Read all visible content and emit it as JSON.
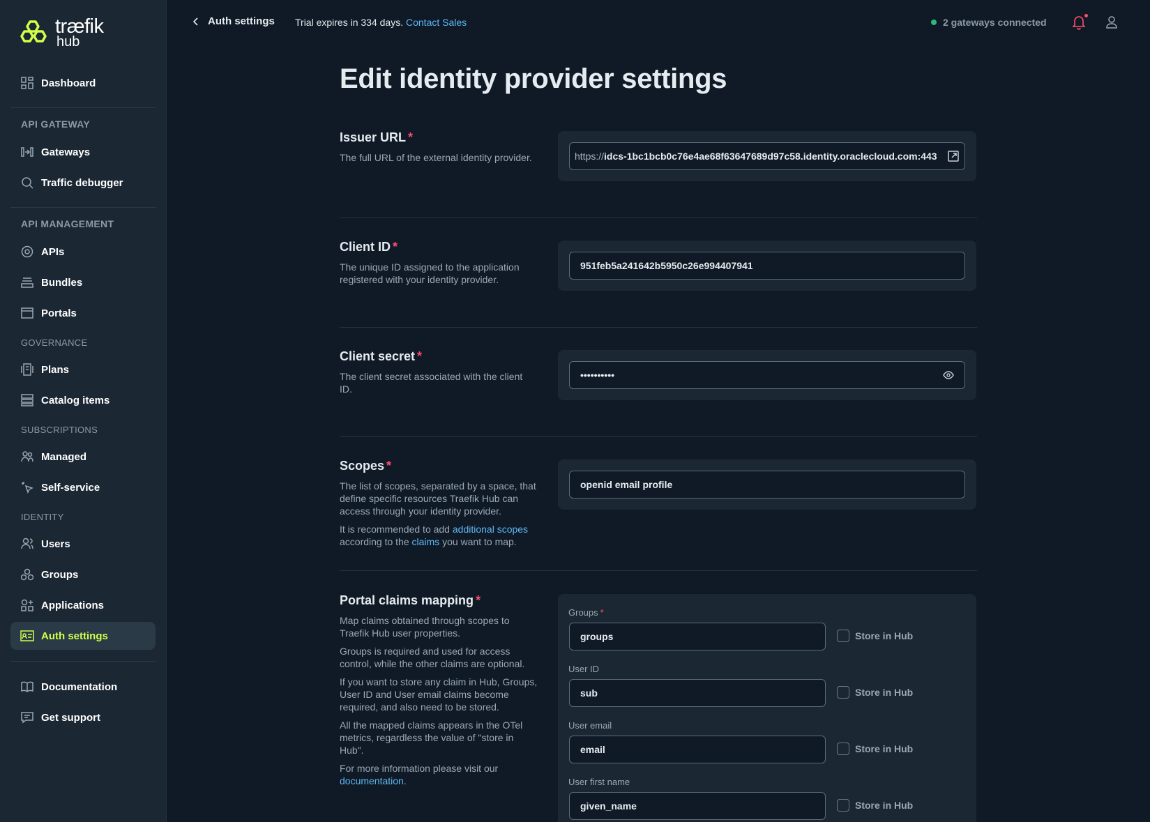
{
  "brand": {
    "name_line1": "træfik",
    "name_line2": "hub",
    "accent": "#d2ff4a"
  },
  "sidebar": {
    "dashboard": "Dashboard",
    "api_gateway_heading": "API GATEWAY",
    "gateways": "Gateways",
    "traffic_debugger": "Traffic debugger",
    "api_management_heading": "API MANAGEMENT",
    "apis": "APIs",
    "bundles": "Bundles",
    "portals": "Portals",
    "governance_heading": "GOVERNANCE",
    "plans": "Plans",
    "catalog_items": "Catalog items",
    "subscriptions_heading": "SUBSCRIPTIONS",
    "managed": "Managed",
    "self_service": "Self-service",
    "identity_heading": "IDENTITY",
    "users": "Users",
    "groups": "Groups",
    "applications": "Applications",
    "auth_settings": "Auth settings",
    "documentation": "Documentation",
    "get_support": "Get support"
  },
  "topbar": {
    "back_label": "Auth settings",
    "trial_text": "Trial expires in 334 days.",
    "contact_sales": "Contact Sales",
    "gateways_status": "2 gateways connected"
  },
  "page": {
    "title": "Edit identity provider settings",
    "issuer": {
      "label": "Issuer URL",
      "required": "*",
      "description": "The full URL of the external identity provider.",
      "value_prefix": "https://",
      "value_rest": "idcs-1bc1bcb0c76e4ae68f63647689d97c58.identity.oraclecloud.com:443"
    },
    "client_id": {
      "label": "Client ID",
      "required": "*",
      "description": "The unique ID assigned to the application registered with your identity provider.",
      "value": "951feb5a241642b5950c26e994407941"
    },
    "client_secret": {
      "label": "Client secret",
      "required": "*",
      "description": "The client secret associated with the client ID.",
      "value": "••••••••••"
    },
    "scopes": {
      "label": "Scopes",
      "required": "*",
      "description": "The list of scopes, separated by a space, that define specific resources Traefik Hub can access through your identity provider.",
      "rec_prefix": "It is recommended to add",
      "rec_link1": "additional scopes",
      "rec_middle": "according to the",
      "rec_link2": "claims",
      "rec_suffix": "you want to map.",
      "value": "openid email profile"
    },
    "claims": {
      "label": "Portal claims mapping",
      "required": "*",
      "desc1": "Map claims obtained through scopes to Traefik Hub user properties.",
      "desc2": "Groups is required and used for access control, while the other claims are optional.",
      "desc3": "If you want to store any claim in Hub, Groups, User ID and User email claims become required, and also need to be stored.",
      "desc4": "All the mapped claims appears in the OTel metrics, regardless the value of \"store in Hub\".",
      "desc5_prefix": "For more information please visit our",
      "desc5_link": "documentation",
      "desc5_suffix": ".",
      "store_label": "Store in Hub",
      "items": [
        {
          "label": "Groups",
          "required": "*",
          "value": "groups"
        },
        {
          "label": "User ID",
          "value": "sub"
        },
        {
          "label": "User email",
          "value": "email"
        },
        {
          "label": "User first name",
          "value": "given_name"
        }
      ]
    }
  }
}
